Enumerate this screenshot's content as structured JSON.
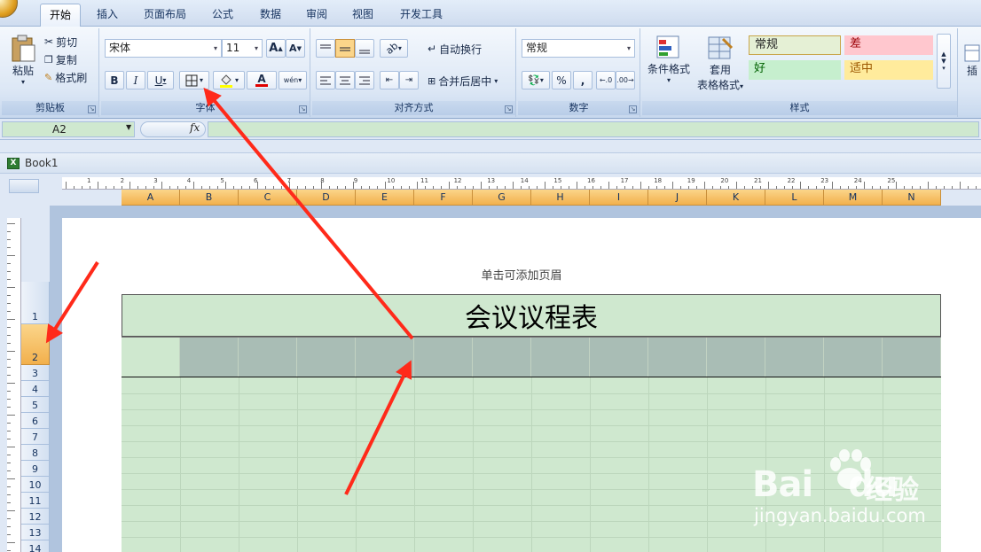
{
  "tabs": [
    {
      "label": "开始",
      "active": true
    },
    {
      "label": "插入"
    },
    {
      "label": "页面布局"
    },
    {
      "label": "公式"
    },
    {
      "label": "数据"
    },
    {
      "label": "审阅"
    },
    {
      "label": "视图"
    },
    {
      "label": "开发工具"
    }
  ],
  "ribbon": {
    "clipboard": {
      "label": "剪贴板",
      "paste": "粘贴",
      "cut": "剪切",
      "copy": "复制",
      "format_painter": "格式刷"
    },
    "font": {
      "label": "字体",
      "font_name": "宋体",
      "font_size": "11",
      "grow": "A",
      "shrink": "A",
      "bold": "B",
      "italic": "I",
      "underline": "U",
      "font_color_glyph": "A",
      "phonetic": "wén"
    },
    "alignment": {
      "label": "对齐方式",
      "wrap": "自动换行",
      "merge": "合并后居中"
    },
    "number": {
      "label": "数字",
      "format": "常规",
      "percent": "%",
      "comma": ","
    },
    "styles": {
      "label": "样式",
      "cond_format": "条件格式",
      "table_format_1": "套用",
      "table_format_2": "表格格式",
      "normal": "常规",
      "bad": "差",
      "good": "好",
      "neutral": "适中"
    },
    "insert_partial": "插"
  },
  "colors": {
    "accent_header": "#f2b04c",
    "sheet_fill": "#cfe8cf",
    "row2_fill": "#a9bdb5",
    "arrow": "#ff2a1a"
  },
  "namebox": {
    "value": "A2",
    "fx": "fx"
  },
  "workbook": {
    "name": "Book1"
  },
  "ruler": {
    "numbers": [
      "1",
      "2",
      "3",
      "4",
      "5",
      "6",
      "7",
      "8",
      "9",
      "10",
      "11",
      "12",
      "13",
      "14",
      "15",
      "16",
      "17",
      "18",
      "19",
      "20",
      "21",
      "22",
      "23",
      "24",
      "25"
    ]
  },
  "columns": [
    "A",
    "B",
    "C",
    "D",
    "E",
    "F",
    "G",
    "H",
    "I",
    "J",
    "K",
    "L",
    "M",
    "N"
  ],
  "rows": [
    "1",
    "2",
    "3",
    "4",
    "5",
    "6",
    "7",
    "8",
    "9",
    "10",
    "11",
    "12",
    "13",
    "14"
  ],
  "sheet": {
    "header_hint": "单击可添加页眉",
    "title": "会议议程表"
  },
  "watermark": {
    "brand": "Bai",
    "brand2": "du",
    "cn": "经验",
    "url": "jingyan.baidu.com"
  }
}
